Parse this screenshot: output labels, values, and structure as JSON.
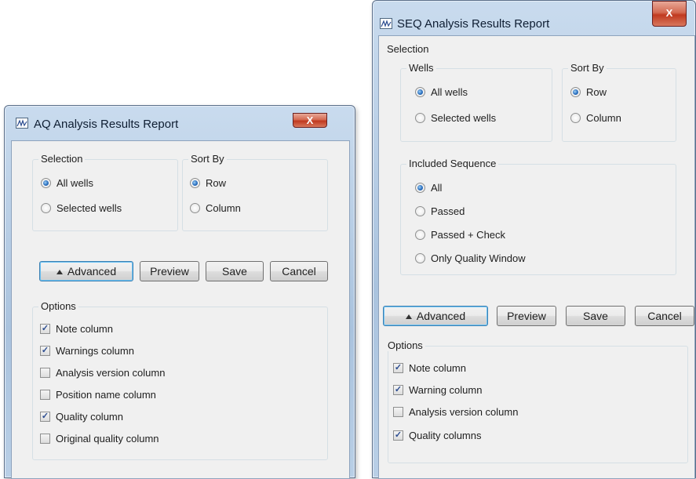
{
  "aq": {
    "title": "AQ Analysis Results Report",
    "close_glyph": "X",
    "selection_label": "Selection",
    "selection_options": [
      "All wells",
      "Selected wells"
    ],
    "sortby_label": "Sort By",
    "sortby_options": [
      "Row",
      "Column"
    ],
    "buttons": {
      "advanced": "Advanced",
      "preview": "Preview",
      "save": "Save",
      "cancel": "Cancel"
    },
    "options_label": "Options",
    "options": [
      {
        "label": "Note column",
        "checked": true
      },
      {
        "label": "Warnings column",
        "checked": true
      },
      {
        "label": "Analysis version column",
        "checked": false
      },
      {
        "label": "Position name column",
        "checked": false
      },
      {
        "label": "Quality column",
        "checked": true
      },
      {
        "label": "Original quality column",
        "checked": false
      }
    ]
  },
  "seq": {
    "title": "SEQ Analysis Results Report",
    "close_glyph": "X",
    "selection_label": "Selection",
    "wells_label": "Wells",
    "wells_options": [
      "All wells",
      "Selected wells"
    ],
    "sortby_label": "Sort By",
    "sortby_options": [
      "Row",
      "Column"
    ],
    "included_label": "Included Sequence",
    "included_options": [
      "All",
      "Passed",
      "Passed + Check",
      "Only Quality Window"
    ],
    "buttons": {
      "advanced": "Advanced",
      "preview": "Preview",
      "save": "Save",
      "cancel": "Cancel"
    },
    "options_label": "Options",
    "options": [
      {
        "label": "Note column",
        "checked": true
      },
      {
        "label": "Warning column",
        "checked": true
      },
      {
        "label": "Analysis version column",
        "checked": false
      },
      {
        "label": "Quality columns",
        "checked": true
      }
    ]
  }
}
